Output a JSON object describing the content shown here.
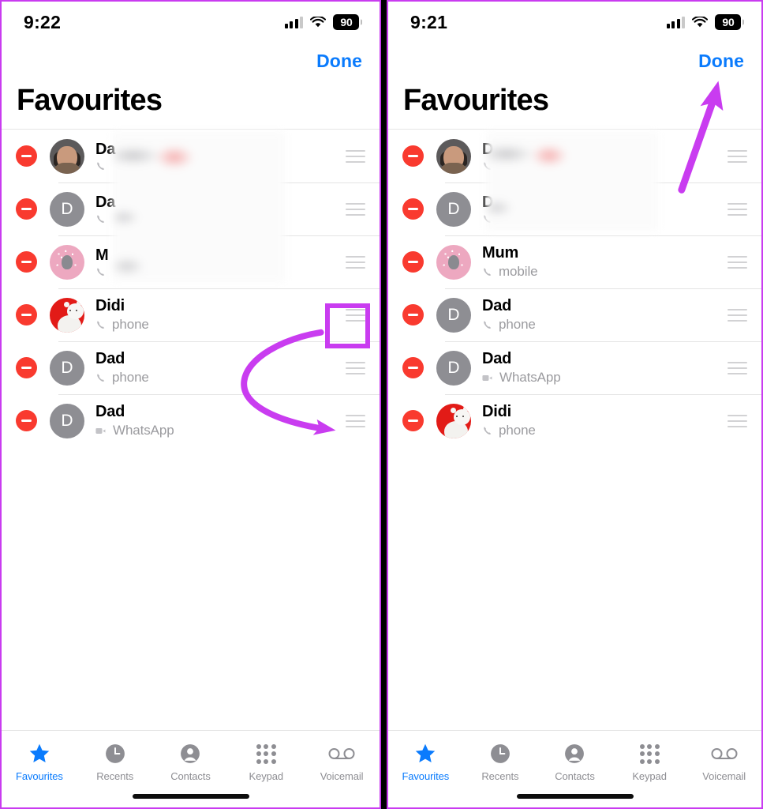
{
  "app": {
    "name": "Phone",
    "screen": "Favourites edit mode"
  },
  "accent": {
    "blue": "#0a7bfd",
    "purple": "#c93cf0",
    "red": "#f93a2f",
    "gray": "#8e8e93"
  },
  "panels": [
    {
      "id": "before",
      "status": {
        "time": "9:22",
        "battery": "90",
        "signal_icon": "cellular-signal-icon",
        "wifi_icon": "wifi-icon",
        "battery_icon": "battery-icon"
      },
      "nav": {
        "done_label": "Done"
      },
      "title": "Favourites",
      "rows": [
        {
          "name": "Da",
          "label": "",
          "line_icon": "phone-icon",
          "avatar": "photo",
          "initial": "",
          "blurred": true
        },
        {
          "name": "Da",
          "label": "",
          "line_icon": "phone-icon",
          "avatar": "initial",
          "initial": "D",
          "blurred": true
        },
        {
          "name": "M",
          "label": "",
          "line_icon": "phone-icon",
          "avatar": "pink",
          "initial": "",
          "blurred": true
        },
        {
          "name": "Didi",
          "label": "phone",
          "line_icon": "phone-icon",
          "avatar": "red",
          "initial": "",
          "blurred": false
        },
        {
          "name": "Dad",
          "label": "phone",
          "line_icon": "phone-icon",
          "avatar": "initial",
          "initial": "D",
          "blurred": false
        },
        {
          "name": "Dad",
          "label": "WhatsApp",
          "line_icon": "video-camera-icon",
          "avatar": "initial",
          "initial": "D",
          "blurred": false
        }
      ],
      "annotations": {
        "highlight": "reorder-handle-highlight",
        "arrow": "drag-handle-curved-arrow"
      }
    },
    {
      "id": "after",
      "status": {
        "time": "9:21",
        "battery": "90",
        "signal_icon": "cellular-signal-icon",
        "wifi_icon": "wifi-icon",
        "battery_icon": "battery-icon"
      },
      "nav": {
        "done_label": "Done"
      },
      "title": "Favourites",
      "rows": [
        {
          "name": "D",
          "label": "",
          "line_icon": "phone-icon",
          "avatar": "photo",
          "initial": "",
          "blurred": true
        },
        {
          "name": "D",
          "label": "",
          "line_icon": "phone-icon",
          "avatar": "initial",
          "initial": "D",
          "blurred": true
        },
        {
          "name": "Mum",
          "label": "mobile",
          "line_icon": "phone-icon",
          "avatar": "pink",
          "initial": "",
          "blurred": false
        },
        {
          "name": "Dad",
          "label": "phone",
          "line_icon": "phone-icon",
          "avatar": "initial",
          "initial": "D",
          "blurred": false
        },
        {
          "name": "Dad",
          "label": "WhatsApp",
          "line_icon": "video-camera-icon",
          "avatar": "initial",
          "initial": "D",
          "blurred": false
        },
        {
          "name": "Didi",
          "label": "phone",
          "line_icon": "phone-icon",
          "avatar": "red",
          "initial": "",
          "blurred": false
        }
      ],
      "annotations": {
        "arrow": "done-button-arrow"
      }
    }
  ],
  "tabs": [
    {
      "label": "Favourites",
      "icon": "star-icon",
      "active": true
    },
    {
      "label": "Recents",
      "icon": "clock-icon",
      "active": false
    },
    {
      "label": "Contacts",
      "icon": "person-icon",
      "active": false
    },
    {
      "label": "Keypad",
      "icon": "keypad-icon",
      "active": false
    },
    {
      "label": "Voicemail",
      "icon": "voicemail-icon",
      "active": false
    }
  ]
}
